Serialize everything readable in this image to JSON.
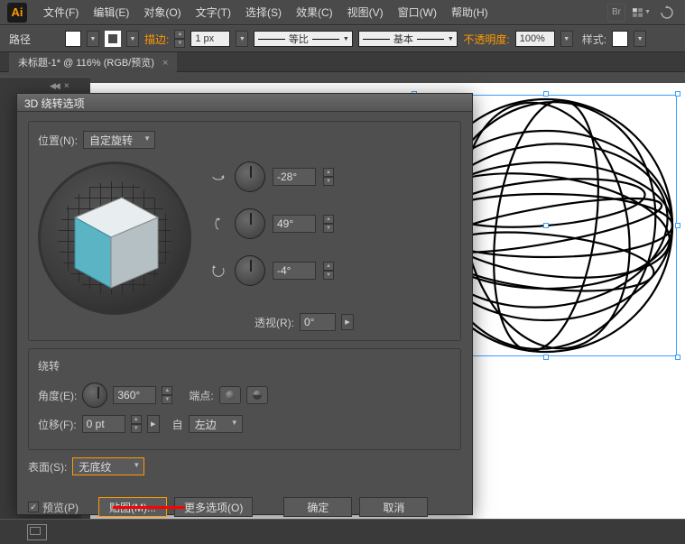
{
  "app": {
    "logo": "Ai"
  },
  "menu": {
    "items": [
      "文件(F)",
      "编辑(E)",
      "对象(O)",
      "文字(T)",
      "选择(S)",
      "效果(C)",
      "视图(V)",
      "窗口(W)",
      "帮助(H)"
    ]
  },
  "optionsbar": {
    "tool_label": "路径",
    "stroke_label": "描边:",
    "stroke_weight": "1 px",
    "stroke_style1": "等比",
    "stroke_style2": "基本",
    "opacity_label": "不透明度:",
    "opacity_value": "100%",
    "style_label": "样式:"
  },
  "doc_tab": {
    "title": "未标题-1* @ 116% (RGB/预览)",
    "close": "×"
  },
  "dialog": {
    "title": "3D 绕转选项",
    "position_label": "位置(N):",
    "position_value": "自定旋转",
    "angle_x": "-28°",
    "angle_y": "49°",
    "angle_z": "-4°",
    "perspective_label": "透视(R):",
    "perspective_value": "0°",
    "revolve_section": "绕转",
    "degree_label": "角度(E):",
    "degree_value": "360°",
    "cap_label": "端点:",
    "offset_label": "位移(F):",
    "offset_value": "0 pt",
    "from_label": "自",
    "from_value": "左边",
    "surface_label": "表面(S):",
    "surface_value": "无底纹",
    "preview_label": "预览(P)",
    "map_btn": "贴图(M)...",
    "more_btn": "更多选项(O)",
    "ok_btn": "确定",
    "cancel_btn": "取消"
  }
}
